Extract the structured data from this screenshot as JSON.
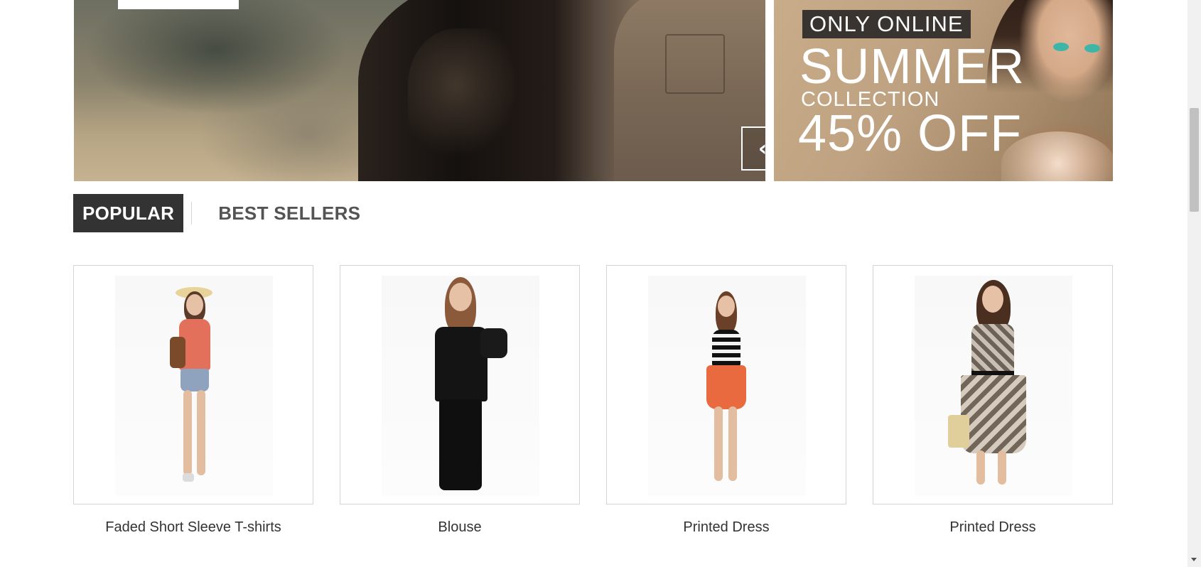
{
  "slider": {
    "prev_icon": "chevron-left-icon",
    "next_icon": "chevron-right-icon",
    "prev_glyph": "‹",
    "next_glyph": "›"
  },
  "promo": {
    "tag": "ONLY ONLINE",
    "headline": "SUMMER",
    "subline": "COLLECTION",
    "offer": "45% OFF"
  },
  "tabs": [
    {
      "label": "POPULAR",
      "active": true
    },
    {
      "label": "BEST SELLERS",
      "active": false
    }
  ],
  "products": [
    {
      "name": "Faded Short Sleeve T-shirts"
    },
    {
      "name": "Blouse"
    },
    {
      "name": "Printed Dress"
    },
    {
      "name": "Printed Dress"
    }
  ],
  "colors": {
    "tab_active_bg": "#333333",
    "text": "#333333",
    "border": "#d6d4d4"
  }
}
